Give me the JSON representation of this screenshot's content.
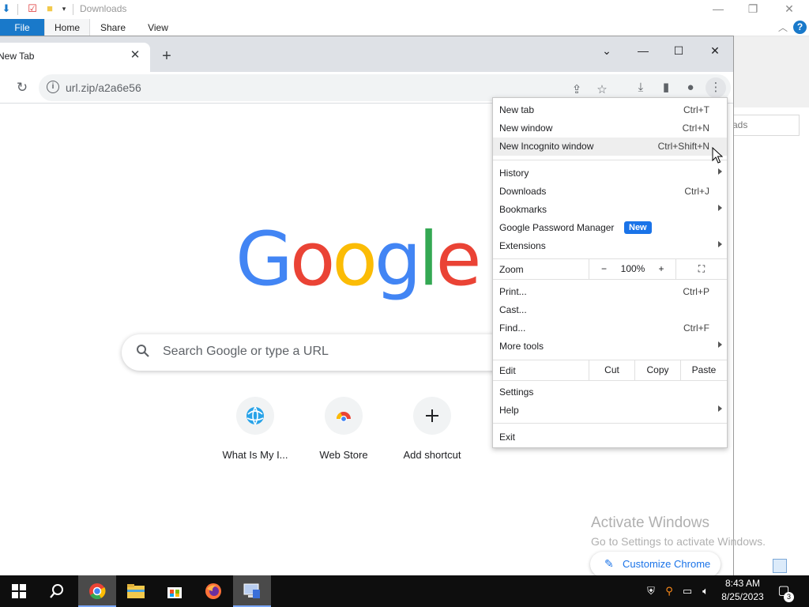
{
  "explorer": {
    "title": "Downloads",
    "tabs": {
      "file": "File",
      "home": "Home",
      "share": "Share",
      "view": "View"
    },
    "search_partial": "ads",
    "help": "?"
  },
  "chrome": {
    "tab_title": "New Tab",
    "tab_close": "✕",
    "new_tab": "+",
    "url": "url.zip/a2a6e56",
    "window_controls": {
      "tab_search": "⌄",
      "minimize": "—",
      "maximize": "☐",
      "close": "✕"
    }
  },
  "ntp": {
    "logo": [
      "G",
      "o",
      "o",
      "g",
      "l",
      "e"
    ],
    "logo_colors": [
      "#4285f4",
      "#ea4335",
      "#fbbc05",
      "#4285f4",
      "#34a853",
      "#ea4335"
    ],
    "search_placeholder": "Search Google or type a URL",
    "shortcuts": [
      {
        "label": "What Is My I...",
        "icon": "globe-icon"
      },
      {
        "label": "Web Store",
        "icon": "web-store-icon"
      },
      {
        "label": "Add shortcut",
        "icon": "plus-icon"
      }
    ],
    "customize_label": "Customize Chrome"
  },
  "menu": {
    "items": [
      {
        "label": "New tab",
        "shortcut": "Ctrl+T"
      },
      {
        "label": "New window",
        "shortcut": "Ctrl+N"
      },
      {
        "label": "New Incognito window",
        "shortcut": "Ctrl+Shift+N"
      },
      {
        "label": "History",
        "submenu": true
      },
      {
        "label": "Downloads",
        "shortcut": "Ctrl+J"
      },
      {
        "label": "Bookmarks",
        "submenu": true
      },
      {
        "label": "Google Password Manager",
        "badge": "New"
      },
      {
        "label": "Extensions",
        "submenu": true
      },
      {
        "label": "Print...",
        "shortcut": "Ctrl+P"
      },
      {
        "label": "Cast..."
      },
      {
        "label": "Find...",
        "shortcut": "Ctrl+F"
      },
      {
        "label": "More tools",
        "submenu": true
      },
      {
        "label": "Settings"
      },
      {
        "label": "Help",
        "submenu": true
      },
      {
        "label": "Exit"
      }
    ],
    "zoom": {
      "label": "Zoom",
      "minus": "−",
      "value": "100%",
      "plus": "+"
    },
    "edit": {
      "label": "Edit",
      "cut": "Cut",
      "copy": "Copy",
      "paste": "Paste"
    }
  },
  "watermark": {
    "title": "Activate Windows",
    "subtitle": "Go to Settings to activate Windows."
  },
  "taskbar": {
    "time": "8:43 AM",
    "date": "8/25/2023",
    "notification_count": "3"
  },
  "colors": {
    "accent": "#1a73e8",
    "explorer_file_tab": "#1979ca",
    "taskbar": "#0e0e0e"
  }
}
